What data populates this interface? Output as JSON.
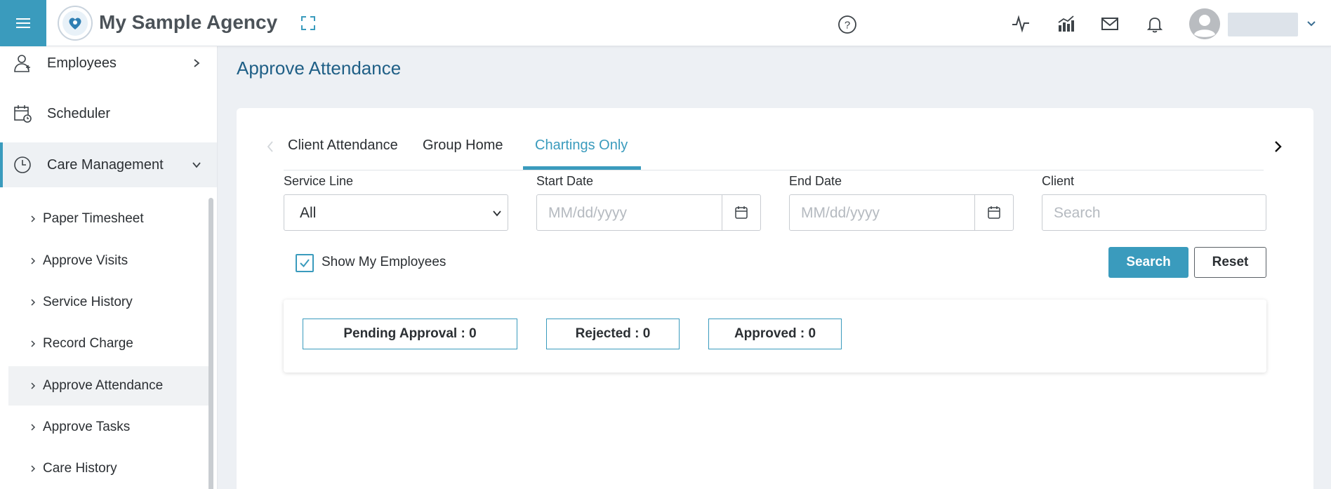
{
  "app": {
    "title": "My Sample Agency"
  },
  "icons": {
    "menu": "hamburger-icon",
    "logo": "agency-logo",
    "expand": "fullscreen-icon",
    "help": "help-icon",
    "activity": "activity-icon",
    "analytics": "bar-chart-icon",
    "mail": "mail-icon",
    "notifications": "bell-icon",
    "user": "user-avatar-icon"
  },
  "colors": {
    "accent": "#3a9bbd",
    "title": "#1f5f86",
    "background": "#edf0f4"
  },
  "sidebar": {
    "items": [
      {
        "label": "Employees",
        "icon": "employee-icon"
      },
      {
        "label": "Scheduler",
        "icon": "calendar-clock-icon"
      },
      {
        "label": "Care Management",
        "icon": "clock-icon",
        "expanded": true
      }
    ],
    "sub_items": [
      {
        "label": "Paper Timesheet"
      },
      {
        "label": "Approve Visits"
      },
      {
        "label": "Service History"
      },
      {
        "label": "Record Charge"
      },
      {
        "label": "Approve Attendance",
        "active": true
      },
      {
        "label": "Approve Tasks"
      },
      {
        "label": "Care History"
      }
    ]
  },
  "page": {
    "title": "Approve Attendance"
  },
  "tabs": [
    {
      "label": "Client Attendance"
    },
    {
      "label": "Group Home"
    },
    {
      "label": "Chartings Only",
      "active": true
    }
  ],
  "filters": {
    "service_line": {
      "label": "Service Line",
      "value": "All"
    },
    "start_date": {
      "label": "Start Date",
      "placeholder": "MM/dd/yyyy"
    },
    "end_date": {
      "label": "End Date",
      "placeholder": "MM/dd/yyyy"
    },
    "client": {
      "label": "Client",
      "placeholder": "Search"
    },
    "show_my_employees": {
      "label": "Show My Employees",
      "checked": true
    }
  },
  "buttons": {
    "search": "Search",
    "reset": "Reset"
  },
  "summary": {
    "pending": "Pending Approval : 0",
    "rejected": "Rejected : 0",
    "approved": "Approved : 0"
  }
}
